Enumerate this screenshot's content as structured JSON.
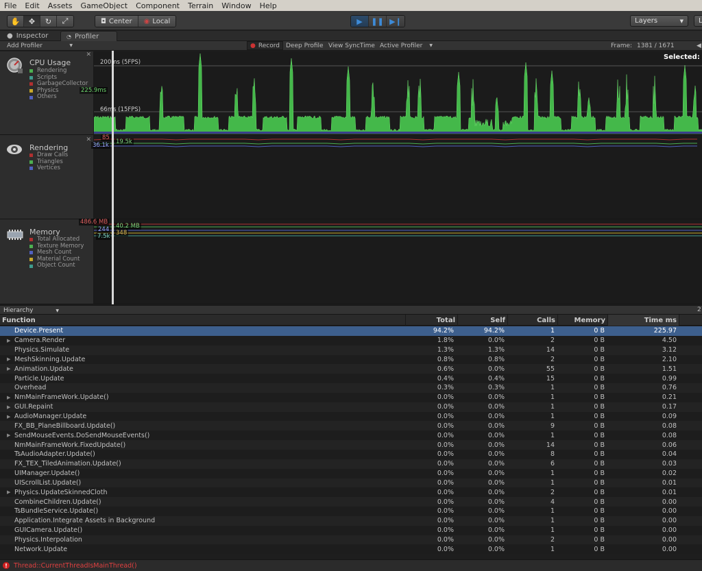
{
  "menu": [
    "File",
    "Edit",
    "Assets",
    "GameObject",
    "Component",
    "Terrain",
    "Window",
    "Help"
  ],
  "toolbar": {
    "pivot_label": "Center",
    "space_label": "Local",
    "layers_label": "Layers",
    "layout_label": "L"
  },
  "tabs": {
    "inspector": "Inspector",
    "profiler": "Profiler"
  },
  "profiler_toolbar": {
    "add_profiler": "Add Profiler",
    "record": "Record",
    "deep_profile": "Deep Profile",
    "view_synctime": "View SyncTime",
    "active_profiler": "Active Profiler",
    "frame_label": "Frame:",
    "frame_value": "1381 / 1671",
    "selected_label": "Selected:"
  },
  "cpu": {
    "title": "CPU Usage",
    "legend": [
      {
        "label": "Rendering",
        "color": "#4caf50"
      },
      {
        "label": "Scripts",
        "color": "#3f9b8c"
      },
      {
        "label": "GarbageCollector",
        "color": "#b03030"
      },
      {
        "label": "Physics",
        "color": "#c8a82a"
      },
      {
        "label": "Others",
        "color": "#5060c0"
      }
    ],
    "line_200": "200ms (5FPS)",
    "line_66": "66ms (15FPS)",
    "cursor_value": "225.9ms"
  },
  "rendering": {
    "title": "Rendering",
    "legend": [
      {
        "label": "Draw Calls",
        "color": "#b03030"
      },
      {
        "label": "Triangles",
        "color": "#4caf50"
      },
      {
        "label": "Vertices",
        "color": "#5060c0"
      }
    ],
    "draw_calls_value": "85",
    "triangles_value": "19.5k",
    "vertices_value": "36.1k"
  },
  "memory": {
    "title": "Memory",
    "legend": [
      {
        "label": "Total Allocated",
        "color": "#b03030"
      },
      {
        "label": "Texture Memory",
        "color": "#4caf50"
      },
      {
        "label": "Mesh Count",
        "color": "#5060c0"
      },
      {
        "label": "Material Count",
        "color": "#c8a82a"
      },
      {
        "label": "Object Count",
        "color": "#3f9b8c"
      }
    ],
    "total_value": "486.6 MB",
    "texture_value": "40.2 MB",
    "mesh_value": "244",
    "material_value": "348",
    "object_value": "7.5k"
  },
  "hierarchy": {
    "mode": "Hierarchy",
    "right_text": "2"
  },
  "table": {
    "headers": {
      "function": "Function",
      "total": "Total",
      "self": "Self",
      "calls": "Calls",
      "memory": "Memory",
      "time": "Time ms"
    },
    "rows": [
      {
        "name": "Device.Present",
        "total": "94.2%",
        "self": "94.2%",
        "calls": "1",
        "memory": "0 B",
        "time": "225.97",
        "expand": false,
        "selected": true
      },
      {
        "name": "Camera.Render",
        "total": "1.8%",
        "self": "0.0%",
        "calls": "2",
        "memory": "0 B",
        "time": "4.50",
        "expand": true
      },
      {
        "name": "Physics.Simulate",
        "total": "1.3%",
        "self": "1.3%",
        "calls": "14",
        "memory": "0 B",
        "time": "3.12",
        "expand": false
      },
      {
        "name": "MeshSkinning.Update",
        "total": "0.8%",
        "self": "0.8%",
        "calls": "2",
        "memory": "0 B",
        "time": "2.10",
        "expand": true
      },
      {
        "name": "Animation.Update",
        "total": "0.6%",
        "self": "0.0%",
        "calls": "55",
        "memory": "0 B",
        "time": "1.51",
        "expand": true
      },
      {
        "name": "Particle.Update",
        "total": "0.4%",
        "self": "0.4%",
        "calls": "15",
        "memory": "0 B",
        "time": "0.99",
        "expand": false
      },
      {
        "name": "Overhead",
        "total": "0.3%",
        "self": "0.3%",
        "calls": "1",
        "memory": "0 B",
        "time": "0.76",
        "expand": false
      },
      {
        "name": "NmMainFrameWork.Update()",
        "total": "0.0%",
        "self": "0.0%",
        "calls": "1",
        "memory": "0 B",
        "time": "0.21",
        "expand": true
      },
      {
        "name": "GUI.Repaint",
        "total": "0.0%",
        "self": "0.0%",
        "calls": "1",
        "memory": "0 B",
        "time": "0.17",
        "expand": true
      },
      {
        "name": "AudioManager.Update",
        "total": "0.0%",
        "self": "0.0%",
        "calls": "1",
        "memory": "0 B",
        "time": "0.09",
        "expand": true
      },
      {
        "name": "FX_BB_PlaneBillboard.Update()",
        "total": "0.0%",
        "self": "0.0%",
        "calls": "9",
        "memory": "0 B",
        "time": "0.08",
        "expand": false
      },
      {
        "name": "SendMouseEvents.DoSendMouseEvents()",
        "total": "0.0%",
        "self": "0.0%",
        "calls": "1",
        "memory": "0 B",
        "time": "0.08",
        "expand": true
      },
      {
        "name": "NmMainFrameWork.FixedUpdate()",
        "total": "0.0%",
        "self": "0.0%",
        "calls": "14",
        "memory": "0 B",
        "time": "0.06",
        "expand": false
      },
      {
        "name": "TsAudioAdapter.Update()",
        "total": "0.0%",
        "self": "0.0%",
        "calls": "8",
        "memory": "0 B",
        "time": "0.04",
        "expand": false
      },
      {
        "name": "FX_TEX_TiledAnimation.Update()",
        "total": "0.0%",
        "self": "0.0%",
        "calls": "6",
        "memory": "0 B",
        "time": "0.03",
        "expand": false
      },
      {
        "name": "UIManager.Update()",
        "total": "0.0%",
        "self": "0.0%",
        "calls": "1",
        "memory": "0 B",
        "time": "0.02",
        "expand": false
      },
      {
        "name": "UIScrollList.Update()",
        "total": "0.0%",
        "self": "0.0%",
        "calls": "1",
        "memory": "0 B",
        "time": "0.01",
        "expand": false
      },
      {
        "name": "Physics.UpdateSkinnedCloth",
        "total": "0.0%",
        "self": "0.0%",
        "calls": "2",
        "memory": "0 B",
        "time": "0.01",
        "expand": true
      },
      {
        "name": "CombineChildren.Update()",
        "total": "0.0%",
        "self": "0.0%",
        "calls": "4",
        "memory": "0 B",
        "time": "0.00",
        "expand": false
      },
      {
        "name": "TsBundleService.Update()",
        "total": "0.0%",
        "self": "0.0%",
        "calls": "1",
        "memory": "0 B",
        "time": "0.00",
        "expand": false
      },
      {
        "name": "Application.Integrate Assets in Background",
        "total": "0.0%",
        "self": "0.0%",
        "calls": "1",
        "memory": "0 B",
        "time": "0.00",
        "expand": false
      },
      {
        "name": "GUICamera.Update()",
        "total": "0.0%",
        "self": "0.0%",
        "calls": "1",
        "memory": "0 B",
        "time": "0.00",
        "expand": false
      },
      {
        "name": "Physics.Interpolation",
        "total": "0.0%",
        "self": "0.0%",
        "calls": "2",
        "memory": "0 B",
        "time": "0.00",
        "expand": false
      },
      {
        "name": "Network.Update",
        "total": "0.0%",
        "self": "0.0%",
        "calls": "1",
        "memory": "0 B",
        "time": "0.00",
        "expand": false
      }
    ]
  },
  "status": {
    "message": "Thread::CurrentThreadIsMainThread()"
  }
}
